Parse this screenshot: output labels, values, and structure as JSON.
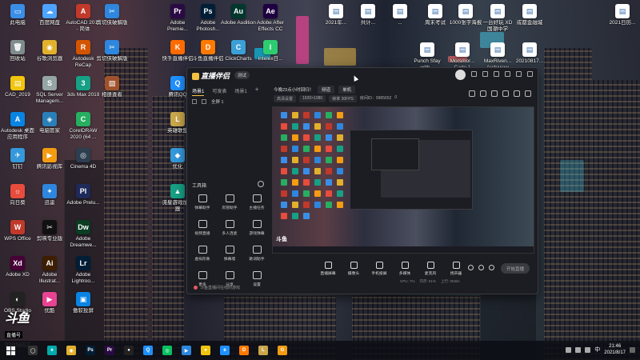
{
  "desktop": {
    "icons": [
      {
        "label": "此电脑",
        "color": "#3a8ee6",
        "glyph": "▭"
      },
      {
        "label": "百度网盘",
        "color": "#4da3ff",
        "glyph": "☁"
      },
      {
        "label": "AutoCAD 2019 - 简体",
        "color": "#c0392b",
        "glyph": "A"
      },
      {
        "label": "剪切侠破解版",
        "color": "#2e86de",
        "glyph": "✂"
      },
      {
        "label": "回收站",
        "color": "#7f8c8d",
        "glyph": "🗑"
      },
      {
        "label": "谷歌浏览器",
        "color": "#e1b12c",
        "glyph": "◉"
      },
      {
        "label": "Autodesk ReCap",
        "color": "#d35400",
        "glyph": "R"
      },
      {
        "label": "剪切侠破解版",
        "color": "#2e86de",
        "glyph": "✂"
      },
      {
        "label": "CAD_2019",
        "color": "#f1c40f",
        "glyph": "▤"
      },
      {
        "label": "SQL Server Managem...",
        "color": "#95a5a6",
        "glyph": "S"
      },
      {
        "label": "3ds Max 2019",
        "color": "#16a085",
        "glyph": "3"
      },
      {
        "label": "相册查看",
        "color": "#a0522d",
        "glyph": "▧"
      },
      {
        "label": "Autodesk 桌面应用程序",
        "color": "#0984e3",
        "glyph": "A"
      },
      {
        "label": "电脑管家",
        "color": "#2980b9",
        "glyph": "◈"
      },
      {
        "label": "CorelDRAW 2020 (64 ...",
        "color": "#27ae60",
        "glyph": "C"
      },
      {
        "label": "钉钉",
        "color": "#3498db",
        "glyph": "✈"
      },
      {
        "label": "腾讯影视库",
        "color": "#f39c12",
        "glyph": "▶"
      },
      {
        "label": "Cinema 4D",
        "color": "#2c3e50",
        "glyph": "◎"
      },
      {
        "label": "向日葵",
        "color": "#e74c3c",
        "glyph": "☼"
      },
      {
        "label": "迅雷",
        "color": "#2e86de",
        "glyph": "✦"
      },
      {
        "label": "Adobe Prelu...",
        "color": "#1e2a5a",
        "glyph": "Pl"
      },
      {
        "label": "WPS Office",
        "color": "#c0392b",
        "glyph": "W"
      },
      {
        "label": "剪映专业版",
        "color": "#111111",
        "glyph": "✂"
      },
      {
        "label": "Adobe Dreamwe...",
        "color": "#0b3d23",
        "glyph": "Dw"
      },
      {
        "label": "Adobe XD",
        "color": "#470137",
        "glyph": "Xd"
      },
      {
        "label": "Adobe Illustrat...",
        "color": "#3d1e00",
        "glyph": "Ai"
      },
      {
        "label": "Adobe Lightroo...",
        "color": "#001e36",
        "glyph": "Lr"
      },
      {
        "label": "OBS Studio",
        "color": "#222222",
        "glyph": "◐"
      },
      {
        "label": "优酷",
        "color": "#e84393",
        "glyph": "▶"
      },
      {
        "label": "傲软投屏",
        "color": "#0984e3",
        "glyph": "▣"
      },
      {
        "label": "Adobe Premie...",
        "color": "#2a0a44",
        "glyph": "Pr"
      },
      {
        "label": "Adobe Photosh...",
        "color": "#001e36",
        "glyph": "Ps"
      },
      {
        "label": "Adobe Audition",
        "color": "#00382d",
        "glyph": "Au"
      },
      {
        "label": "Adobe After Effects CC",
        "color": "#1f0040",
        "glyph": "Ae"
      },
      {
        "label": "快手直播伴侣",
        "color": "#ff6b00",
        "glyph": "K"
      },
      {
        "label": "斗鱼直播伴侣",
        "color": "#ff7a00",
        "glyph": "D"
      },
      {
        "label": "ClickCharts",
        "color": "#3aa0d6",
        "glyph": "C"
      },
      {
        "label": "Intelex日...",
        "color": "#2ecc71",
        "glyph": "I"
      },
      {
        "label": "腾讯QQ",
        "color": "#1e90ff",
        "glyph": "Q"
      },
      {
        "label": "英雄联盟",
        "color": "#c9a64a",
        "glyph": "L"
      },
      {
        "label": "优化",
        "color": "#3498db",
        "glyph": "◆"
      },
      {
        "label": "流星游戏加速器",
        "color": "#16a085",
        "glyph": "▲"
      }
    ],
    "icons_right": [
      {
        "label": "2021年...",
        "color": "#ffffff",
        "glyph": "▤"
      },
      {
        "label": "共计...",
        "color": "#ffffff",
        "glyph": "▤"
      },
      {
        "label": "...",
        "color": "#ffffff",
        "glyph": "▤"
      },
      {
        "label": "周末考试",
        "color": "#ffffff",
        "glyph": "▤"
      },
      {
        "label": "1000张字海报",
        "color": "#ffffff",
        "glyph": "▤"
      },
      {
        "label": "一台好玩 XD 国潮中学",
        "color": "#ffffff",
        "glyph": "▤"
      },
      {
        "label": "成都金融城",
        "color": "#ffffff",
        "glyph": "▤"
      },
      {
        "label": "2021日历...",
        "color": "#ffffff",
        "glyph": "▤"
      },
      {
        "label": "Punch Sfay with...",
        "color": "#ffffff",
        "glyph": "▤"
      },
      {
        "label": "Morsmor... Cade 1",
        "color": "#ffffff",
        "glyph": "▤"
      },
      {
        "label": "MaxRiven... Archiview",
        "color": "#ffffff",
        "glyph": "▤"
      },
      {
        "label": "20210817...",
        "color": "#ffffff",
        "glyph": "▤"
      }
    ],
    "streamer": {
      "logo": "斗鱼",
      "sub": "直播号",
      "room_number": "9985652"
    }
  },
  "app": {
    "title": "直播伴侣",
    "badge": "测试",
    "tabs": [
      "场景1",
      "可发表",
      "场景1"
    ],
    "scene_label": "全屏 1",
    "stream_title": "今晚23点小时回归！",
    "category_label": "频道",
    "category_value": "单机",
    "quality_label": "高清设置",
    "resolution": "1920×1080",
    "fps": "帧率 30FPS",
    "room_id": "房间ID：9985652",
    "viewers": "0",
    "tools_title": "工具箱",
    "tools": [
      "弹幕助手",
      "房管助手",
      "主播任务",
      "视频直播",
      "多人连麦",
      "游戏弹幕",
      "虚拟形象",
      "弹幕墙",
      "歌词助手",
      "更多",
      "分享",
      "设置"
    ],
    "bottom_tools": [
      "直播屏幕",
      "摄像头",
      "手机投屏",
      "多媒体",
      "麦克风",
      "扬声器"
    ],
    "start_button": "开始直播",
    "hint": "斗鱼直播间在线的游戏",
    "status": [
      "CPU: 7%",
      "内存: 51%",
      "上行: 0KB/s"
    ]
  },
  "taskbar": {
    "items": [
      {
        "name": "search",
        "glyph": "◯",
        "color": "#333"
      },
      {
        "name": "edge",
        "glyph": "e",
        "color": "#0aa"
      },
      {
        "name": "chrome",
        "glyph": "◉",
        "color": "#e1b12c"
      },
      {
        "name": "photoshop",
        "glyph": "Ps",
        "color": "#001e36"
      },
      {
        "name": "premiere",
        "glyph": "Pr",
        "color": "#2a0a44"
      },
      {
        "name": "wechat",
        "glyph": "●",
        "color": "#222"
      },
      {
        "name": "qq",
        "glyph": "Q",
        "color": "#1e90ff"
      },
      {
        "name": "wechat2",
        "glyph": "◎",
        "color": "#07c160"
      },
      {
        "name": "video",
        "glyph": "▶",
        "color": "#2e86de"
      },
      {
        "name": "yellow",
        "glyph": "●",
        "color": "#f1c40f"
      },
      {
        "name": "browser",
        "glyph": "e",
        "color": "#1e90ff"
      },
      {
        "name": "douyu",
        "glyph": "D",
        "color": "#ff7a00"
      },
      {
        "name": "lol",
        "glyph": "L",
        "color": "#c9a64a"
      },
      {
        "name": "g",
        "glyph": "G",
        "color": "#f39c12"
      }
    ],
    "time": "21:46",
    "date": "2021/8/17",
    "ime": "中"
  }
}
